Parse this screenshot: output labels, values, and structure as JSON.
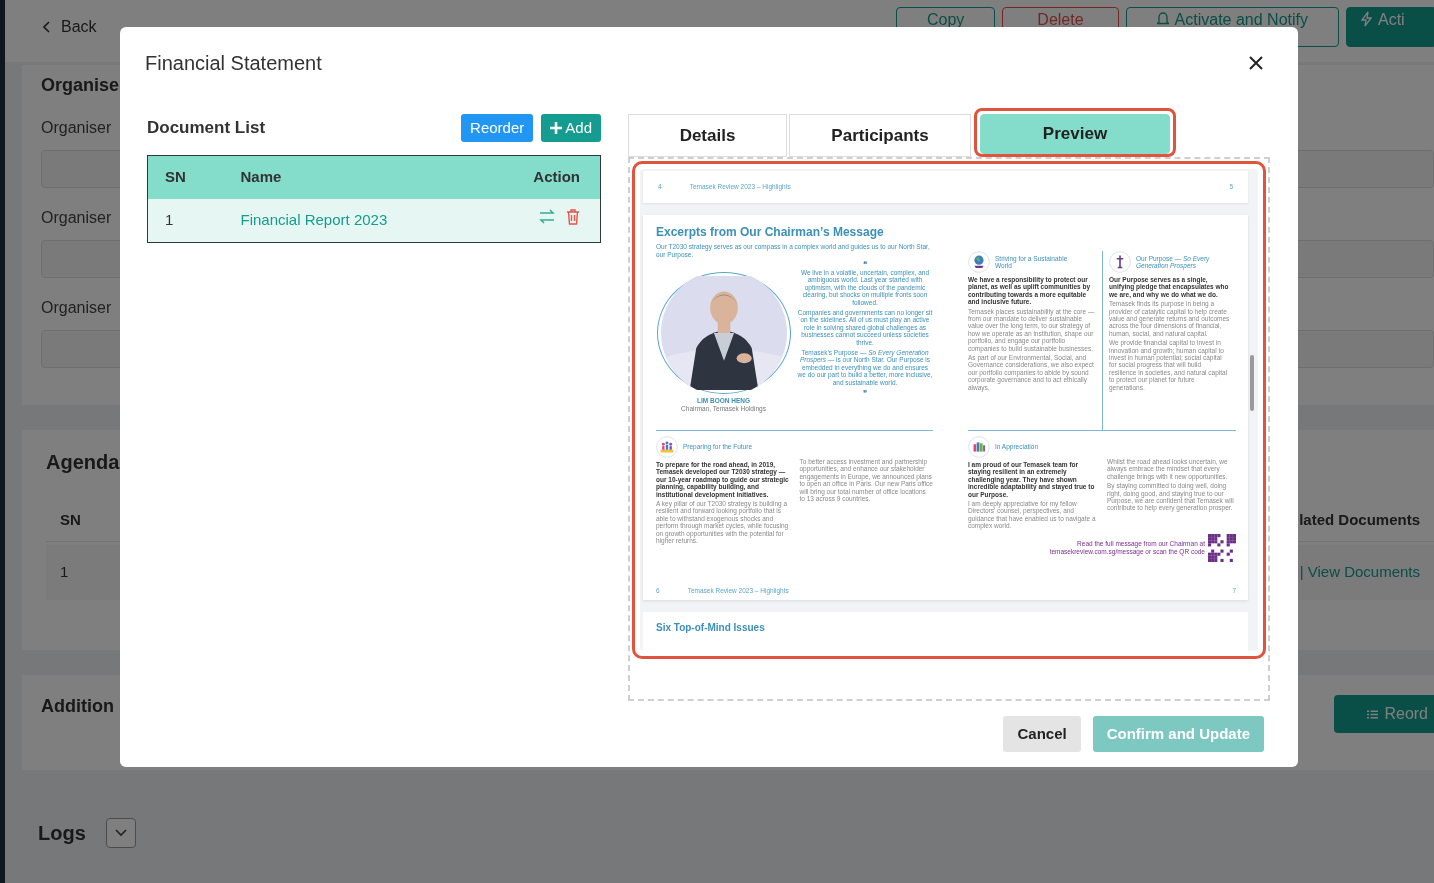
{
  "page": {
    "back": "Back",
    "header_buttons": [
      {
        "label": "Copy",
        "kind": "outline"
      },
      {
        "label": "Delete",
        "kind": "danger"
      },
      {
        "label": "Activate and Notify",
        "kind": "outline-bell"
      },
      {
        "label": "Acti",
        "kind": "solid-bolt"
      }
    ],
    "organiser_section": {
      "title": "Organise",
      "fields": [
        {
          "label": "Organiser"
        },
        {
          "label": "Organiser"
        },
        {
          "label": "Organiser"
        }
      ]
    },
    "agenda": {
      "title": "Agenda",
      "columns": [
        "SN",
        "lated Documents"
      ],
      "rows": [
        {
          "sn": "1",
          "link": "| View Documents"
        }
      ]
    },
    "additional": {
      "title": "Addition",
      "button": "Reord"
    },
    "logs": {
      "title": "Logs"
    }
  },
  "modal": {
    "title": "Financial Statement",
    "document_list": {
      "title": "Document List",
      "buttons": [
        {
          "label": "Reorder",
          "kind": "primary"
        },
        {
          "label": "Add",
          "kind": "add"
        }
      ],
      "columns": [
        "SN",
        "Name",
        "Action"
      ],
      "rows": [
        {
          "sn": "1",
          "name": "Financial Report 2023"
        }
      ]
    },
    "tabs": [
      {
        "label": "Details",
        "selected": false,
        "highlighted": false
      },
      {
        "label": "Participants",
        "selected": false,
        "highlighted": false
      },
      {
        "label": "Preview",
        "selected": true,
        "highlighted": true
      }
    ],
    "preview": {
      "highlighted": true,
      "document": {
        "top_header": {
          "left_page": "4",
          "title": "Temasek Review 2023 – Highlights",
          "right_page": "5"
        },
        "chairman": {
          "heading": "Excerpts from Our Chairman’s Message",
          "intro": "Our T2030 strategy serves as our compass in a complex world and guides us to our North Star, our Purpose.",
          "quote_open": "❝",
          "quote": [
            "We live in a volatile, uncertain, complex, and ambiguous world. Last year started with optimism, with the clouds of the pandemic clearing, but shocks on multiple fronts soon followed.",
            "Companies and governments can no longer sit on the sidelines. All of us must play an active role in solving shared global challenges as businesses cannot succeed unless societies thrive.",
            "Temasek’s Purpose — *So Every Generation Prospers* — is our North Star. Our Purpose is embedded in everything we do and ensures we do our part to build a better, more inclusive, and sustainable world."
          ],
          "quote_close": "❞",
          "name": "LIM BOON HENG",
          "role": "Chairman, Temasek Holdings"
        },
        "top_sections": [
          {
            "kind": "globe",
            "title": "Striving for a Sustainable World",
            "lead": "We have a responsibility to protect our planet, as well as uplift communities by contributing towards a more equitable and inclusive future.",
            "paragraphs": [
              "Temasek places sustainability at the core — from our mandate to deliver sustainable value over the long term, to our strategy of how we operate as an institution, shape our portfolio, and engage our portfolio companies to build sustainable businesses.",
              "As part of our Environmental, Social, and Governance considerations, we also expect our portfolio companies to abide by sound corporate governance and to act ethically always."
            ]
          },
          {
            "kind": "signpost",
            "title": "Our Purpose — *So Every Generation Prospers*",
            "lead": "Our Purpose serves as a single, unifying pledge that encapsulates who we are, and why we do what we do.",
            "paragraphs": [
              "Temasek finds its purpose in being a provider of catalytic capital to help create value and generate returns and outcomes across the four dimensions of financial, human, social, and natural capital.",
              "We provide financial capital to invest in innovation and growth; human capital to invest in human potential; social capital for social progress that will build resilience in societies, and natural capital to protect our planet for future generations."
            ]
          }
        ],
        "bottom_sections": [
          {
            "kind": "people",
            "title": "Preparing for the Future",
            "columns": [
              {
                "lead": "To prepare for the road ahead, in 2019, Temasek developed our T2030 strategy — our 10-year roadmap to guide our strategic planning, capability building, and institutional development initiatives.",
                "paragraphs": [
                  "A key pillar of our T2030 strategy is building a resilient and forward looking portfolio that is able to withstand exogenous shocks and perform through market cycles, while focusing on growth opportunities with the potential for higher returns."
                ]
              },
              {
                "paragraphs": [
                  "To better access investment and partnership opportunities, and enhance our stakeholder engagements in Europe, we announced plans to open an office in Paris. Our new Paris office will bring our total number of office locations to 13 across 9 countries."
                ]
              }
            ]
          },
          {
            "kind": "blocks",
            "title": "In Appreciation",
            "columns": [
              {
                "lead": "I am proud of our Temasek team for staying resilient in an extremely challenging year. They have shown incredible adaptability and stayed true to our Purpose.",
                "paragraphs": [
                  "I am deeply appreciative for my fellow Directors’ counsel, perspectives, and guidance that have enabled us to navigate a complex world."
                ]
              },
              {
                "paragraphs": [
                  "Whilst the road ahead looks uncertain, we always embrace the mindset that every challenge brings with it new opportunities.",
                  "By staying committed to doing well, doing right, doing good, and staying true to our Purpose, we are confident that Temasek will contribute to help every generation prosper."
                ]
              }
            ]
          }
        ],
        "qr_note": "Read the full message from our Chairman at temasekreview.com.sg/message or scan the QR code",
        "footer": {
          "left_page": "6",
          "title": "Temasek Review 2023 – Highlights",
          "right_page": "7"
        },
        "next_heading": "Six Top-of-Mind Issues"
      }
    },
    "footer_buttons": [
      {
        "label": "Cancel",
        "kind": "secondary",
        "disabled": false
      },
      {
        "label": "Confirm and Update",
        "kind": "confirm",
        "disabled": true
      }
    ]
  }
}
